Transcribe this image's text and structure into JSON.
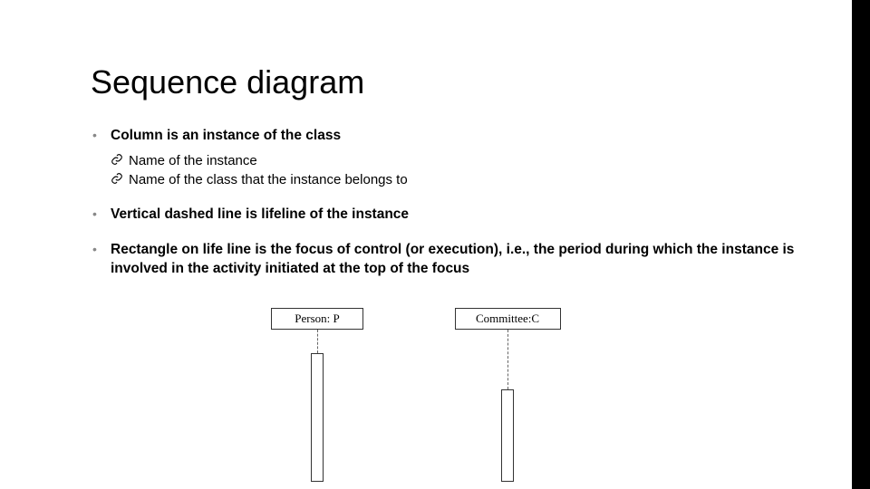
{
  "title": "Sequence diagram",
  "bullets": {
    "b1": "Column is an instance of the class",
    "b1_sub1": "Name of the instance",
    "b1_sub2": "Name of the class that the instance belongs to",
    "b2": "Vertical dashed line is lifeline of the instance",
    "b3": "Rectangle on life line is the focus of control (or execution), i.e., the period during which the instance is involved in the activity initiated at the top of the focus"
  },
  "diagram": {
    "person_label": "Person: P",
    "committee_label": "Committee:C"
  }
}
